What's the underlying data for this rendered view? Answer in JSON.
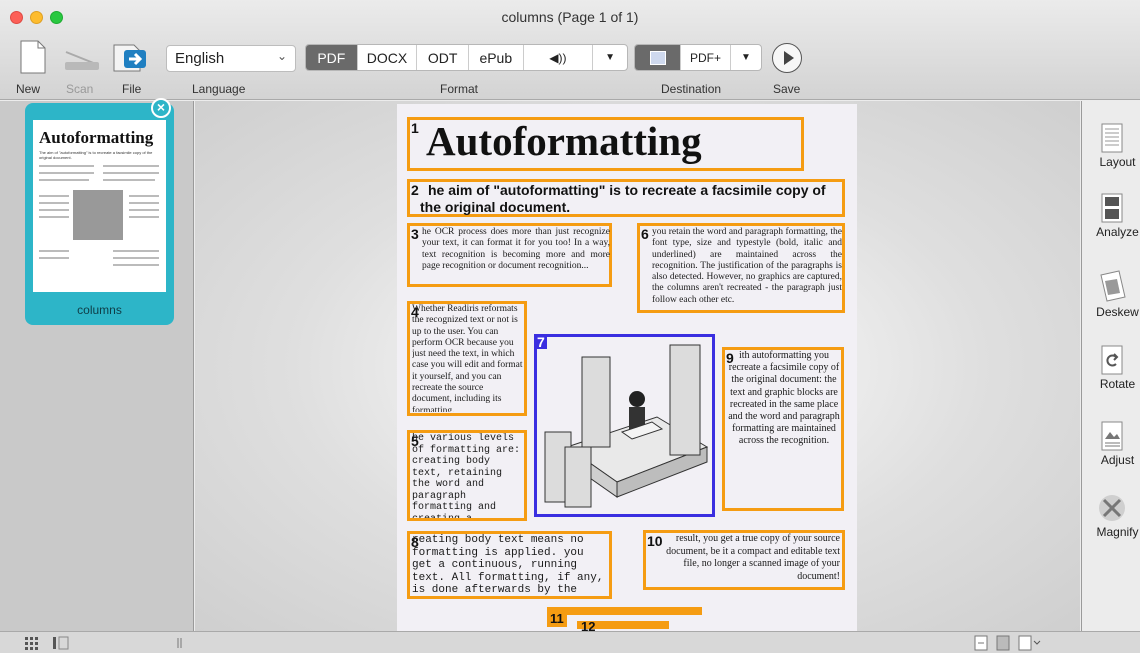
{
  "window": {
    "title": "columns (Page 1 of 1)"
  },
  "toolbar": {
    "new_label": "New",
    "scan_label": "Scan",
    "file_label": "File",
    "language_value": "English",
    "language_label": "Language",
    "formats": [
      "PDF",
      "DOCX",
      "ODT",
      "ePub"
    ],
    "format_active": "PDF",
    "format_label": "Format",
    "destination_value": "PDF+",
    "destination_label": "Destination",
    "save_label": "Save"
  },
  "sidebar": {
    "thumb_title": "Autoformatting",
    "thumb_sub": "The aim of \"autoformatting\" is to recreate a facsimile copy of the original document.",
    "thumb_label": "columns"
  },
  "document": {
    "title": "Autoformatting",
    "subtitle": "he aim of \"autoformatting\" is to recreate a facsimile copy of the original document.",
    "blocks": {
      "b3": "he OCR process does more than just recognize your text, it can format it for you too! In a way, text recognition is becoming more and more page recognition or document recognition...",
      "b4": "Whether Readiris reformats the recognized text or not is up to the user. You can perform OCR because you just need the text, in which case you will edit and format it yourself, and you can recreate the source document, including its formatting.",
      "b5": "he various levels of formatting are: creating body text, retaining the word and paragraph formatting and creating a facsimile copy.",
      "b6": "you retain the word and paragraph formatting, the font type, size and typestyle (bold, italic and underlined) are maintained across the recognition. The justification of the paragraphs is also detected. However, no graphics are captured, the columns aren't recreated - the paragraph just follow each other etc.",
      "b8": "reating body text means no formatting is applied. you get a continuous, running text. All formatting, if any, is done afterwards by the user.",
      "b9": "ith autoformatting you recreate a facsimile copy of the original document: the text and graphic blocks are recreated in the same place and the word and paragraph formatting are maintained across the recognition.",
      "b10": "result, you get a true copy of your source document, be it a compact and editable text file, no longer a scanned image of your document!"
    },
    "region_numbers": [
      "1",
      "2",
      "3",
      "4",
      "5",
      "6",
      "7",
      "8",
      "9",
      "10",
      "11",
      "12"
    ]
  },
  "tools": {
    "layout": "Layout",
    "analyze": "Analyze",
    "deskew": "Deskew",
    "rotate": "Rotate",
    "adjust": "Adjust",
    "magnify": "Magnify"
  },
  "colors": {
    "region": "#f59c12",
    "picture_region": "#3a2ee0",
    "thumb_selected": "#2db5c8"
  }
}
